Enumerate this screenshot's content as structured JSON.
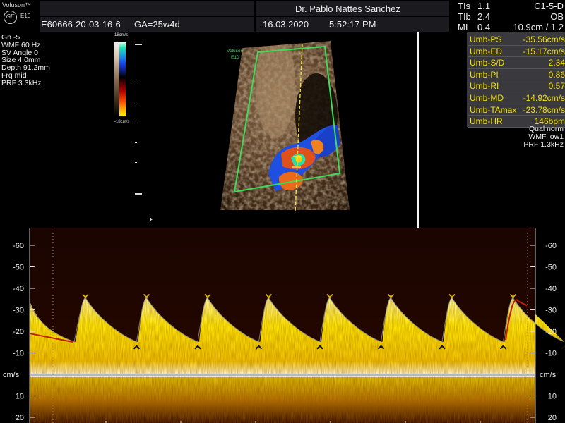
{
  "header": {
    "brand": "Voluson™",
    "logo": "GE",
    "model": "E10",
    "operator": "Dr. Pablo Nattes Sanchez",
    "patient_id": "E60666-20-03-16-6",
    "ga": "GA=25w4d",
    "date": "16.03.2020",
    "time": "5:52:17 PM",
    "indices": [
      {
        "label": "TIs",
        "value": "1.1"
      },
      {
        "label": "TIb",
        "value": "2.4"
      },
      {
        "label": "MI",
        "value": "0.4"
      }
    ],
    "probe": "C1-5-D",
    "app": "OB",
    "depth_scale": "10.9cm / 1.2"
  },
  "params_left": [
    "Gn  -5",
    "WMF 60 Hz",
    "SV Angle  0",
    "Size  4.0mm",
    "Depth 91.2mm",
    "Frq mid",
    "PRF  3.3kHz"
  ],
  "color_scale": {
    "top": "18cm/s",
    "bottom": "-18cm/s"
  },
  "image_tag": {
    "line1": "Voluson",
    "line2": "E10"
  },
  "measurements": [
    {
      "name": "Umb-PS",
      "value": "-35.56cm/s"
    },
    {
      "name": "Umb-ED",
      "value": "-15.17cm/s"
    },
    {
      "name": "Umb-S/D",
      "value": "2.34"
    },
    {
      "name": "Umb-PI",
      "value": "0.86"
    },
    {
      "name": "Umb-RI",
      "value": "0.57"
    },
    {
      "name": "Umb-MD",
      "value": "-14.92cm/s"
    },
    {
      "name": "Umb-TAmax",
      "value": "-23.78cm/s"
    },
    {
      "name": "Umb-HR",
      "value": "146bpm"
    }
  ],
  "params_right": [
    "Qual norm",
    "WMF low1",
    "PRF  1.3kHz"
  ],
  "spectral": {
    "unit": "cm/s",
    "ticks": [
      -60,
      -50,
      -40,
      -30,
      -20,
      -10,
      10,
      20
    ],
    "tick_labels": [
      "-60",
      "-50",
      "-40",
      "-30",
      "-20",
      "-10",
      "10",
      "20"
    ],
    "ymin": -68,
    "ymax": 21,
    "baseline": 0,
    "peak_velocity": -35.56,
    "end_diastolic": -15.17,
    "cycles": 8,
    "colors": {
      "spectrum": "#ffe600",
      "background": "#1a0500",
      "trace": "#8a8a8a",
      "marker": "#e8e8e8",
      "peak_marker": "#d8b400"
    }
  }
}
